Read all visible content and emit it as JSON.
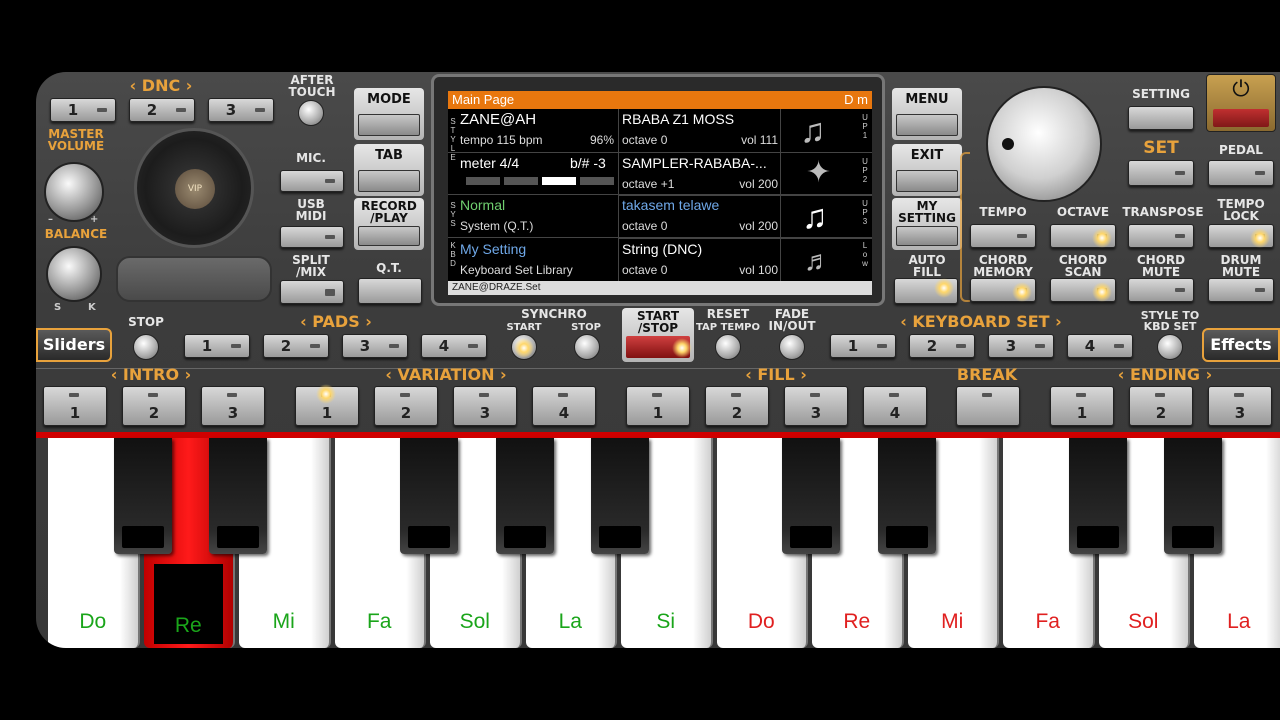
{
  "dnc": {
    "title": "DNC",
    "buttons": [
      "1",
      "2",
      "3"
    ]
  },
  "after_touch": "AFTER\nTOUCH",
  "master_volume": "MASTER\nVOLUME",
  "balance": "BALANCE",
  "balance_marks": {
    "minus": "–",
    "plus": "+",
    "s": "S",
    "k": "K"
  },
  "vip": "VIP",
  "left_controls": {
    "mic": "MIC.",
    "usb_midi": "USB\nMIDI",
    "split_mix": "SPLIT\n/MIX"
  },
  "side_left": {
    "mode": "MODE",
    "tab": "TAB",
    "record_play": "RECORD\n/PLAY",
    "qt": "Q.T."
  },
  "side_right": {
    "menu": "MENU",
    "exit": "EXIT",
    "my_setting": "MY\nSETTING",
    "auto_fill": "AUTO\nFILL"
  },
  "display": {
    "header": "Main Page",
    "chord": "D m",
    "style_tag": "STYLE",
    "sys_tag": "SYS",
    "kbd_tag": "KBD",
    "style_name": "ZANE@AH",
    "tempo": "tempo 115 bpm",
    "percent": "96%",
    "meter": "meter 4/4",
    "transpose": "b/# -3",
    "sys_mode": "Normal",
    "sys_sub": "System (Q.T.)",
    "kbd_mode": "My Setting",
    "kbd_sub": "Keyboard Set Library",
    "parts": [
      {
        "name": "RBABA Z1 MOSS",
        "octave": "octave 0",
        "vol": "vol 111",
        "tag": "UP1"
      },
      {
        "name": "SAMPLER-RABABA-...",
        "octave": "octave +1",
        "vol": "vol 200",
        "tag": "UP2"
      },
      {
        "name": "takasem telawe",
        "octave": "octave 0",
        "vol": "vol 200",
        "tag": "UP3"
      },
      {
        "name": "String (DNC)",
        "octave": "octave 0",
        "vol": "vol 100",
        "tag": "Low"
      }
    ],
    "footer": "ZANE@DRAZE.Set"
  },
  "right_top": {
    "setting": "SETTING",
    "set": "SET",
    "pedal": "PEDAL"
  },
  "right_row1": [
    "TEMPO",
    "OCTAVE",
    "TRANSPOSE",
    "TEMPO\nLOCK"
  ],
  "right_row2": [
    "CHORD\nMEMORY",
    "CHORD\nSCAN",
    "CHORD\nMUTE",
    "DRUM\nMUTE"
  ],
  "row_mid": {
    "sliders": "Sliders",
    "stop": "STOP",
    "pads": "PADS",
    "pad_buttons": [
      "1",
      "2",
      "3",
      "4"
    ],
    "synchro": "SYNCHRO",
    "synchro_start": "START",
    "synchro_stop": "STOP",
    "start_stop": "START\n/STOP",
    "reset": "RESET",
    "tap_tempo": "TAP TEMPO",
    "fade": "FADE\nIN/OUT",
    "keyboard_set": "KEYBOARD SET",
    "kbd_buttons": [
      "1",
      "2",
      "3",
      "4"
    ],
    "style_to_kbd": "STYLE TO\nKBD SET",
    "effects": "Effects"
  },
  "sections": {
    "intro": "INTRO",
    "variation": "VARIATION",
    "fill": "FILL",
    "break": "BREAK",
    "ending": "ENDING"
  },
  "intro_buttons": [
    "1",
    "2",
    "3"
  ],
  "variation_buttons": [
    "1",
    "2",
    "3",
    "4"
  ],
  "fill_buttons": [
    "1",
    "2",
    "3",
    "4"
  ],
  "ending_buttons": [
    "1",
    "2",
    "3"
  ],
  "keys": [
    {
      "note": "Do",
      "color": "#1aa51a"
    },
    {
      "note": "Re",
      "color": "#1aa51a"
    },
    {
      "note": "Mi",
      "color": "#1aa51a"
    },
    {
      "note": "Fa",
      "color": "#1aa51a"
    },
    {
      "note": "Sol",
      "color": "#1aa51a"
    },
    {
      "note": "La",
      "color": "#1aa51a"
    },
    {
      "note": "Si",
      "color": "#1aa51a"
    },
    {
      "note": "Do",
      "color": "#e02020"
    },
    {
      "note": "Re",
      "color": "#e02020"
    },
    {
      "note": "Mi",
      "color": "#e02020"
    },
    {
      "note": "Fa",
      "color": "#e02020"
    },
    {
      "note": "Sol",
      "color": "#e02020"
    },
    {
      "note": "La",
      "color": "#e02020"
    }
  ],
  "colors": {
    "accent": "#e8a23c",
    "display_header": "#e8770e",
    "pressed_key": "#e00000",
    "sys_mode": "#6fcf6f",
    "kbd_mode": "#6fa8e8"
  }
}
